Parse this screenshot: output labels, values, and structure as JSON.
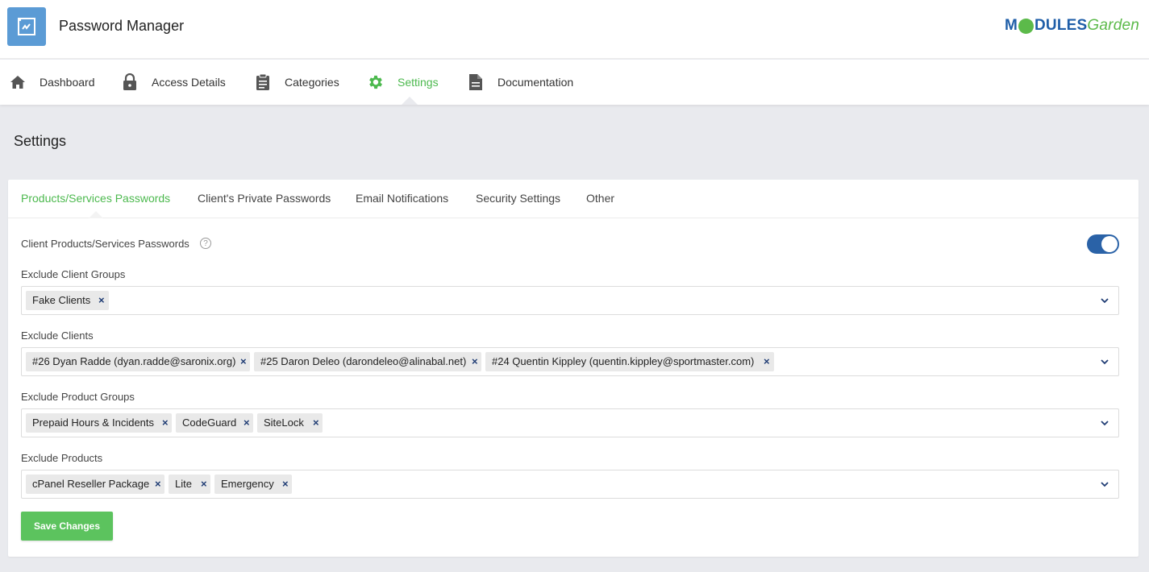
{
  "app": {
    "title": "Password Manager",
    "brand_left": "M",
    "brand_mid": "DULES",
    "brand_right": "Garden"
  },
  "nav": {
    "items": [
      {
        "label": "Dashboard",
        "icon": "home-icon"
      },
      {
        "label": "Access Details",
        "icon": "lock-icon"
      },
      {
        "label": "Categories",
        "icon": "clipboard-icon"
      },
      {
        "label": "Settings",
        "icon": "gear-icon",
        "active": true
      },
      {
        "label": "Documentation",
        "icon": "document-icon"
      }
    ]
  },
  "page": {
    "title": "Settings"
  },
  "tabs": [
    {
      "label": "Products/Services Passwords",
      "active": true
    },
    {
      "label": "Client's Private Passwords"
    },
    {
      "label": "Email Notifications"
    },
    {
      "label": "Security Settings"
    },
    {
      "label": "Other"
    }
  ],
  "form": {
    "toggle_label": "Client Products/Services Passwords",
    "toggle_on": true,
    "help_glyph": "?",
    "remove_glyph": "×",
    "client_groups": {
      "label": "Exclude Client Groups",
      "tags": [
        "Fake Clients"
      ]
    },
    "clients": {
      "label": "Exclude Clients",
      "tags": [
        "#26 Dyan Radde (dyan.radde@saronix.org)",
        "#25 Daron Deleo (darondeleo@alinabal.net)",
        "#24 Quentin Kippley (quentin.kippley@sportmaster.com)"
      ]
    },
    "product_groups": {
      "label": "Exclude Product Groups",
      "tags": [
        "Prepaid Hours & Incidents",
        "CodeGuard",
        "SiteLock"
      ]
    },
    "products": {
      "label": "Exclude Products",
      "tags": [
        "cPanel Reseller Package",
        "Lite",
        "Emergency"
      ]
    },
    "save_label": "Save Changes"
  },
  "colors": {
    "accent": "#4cb94e",
    "brand_blue": "#1f5ea8",
    "toggle": "#2a62a7",
    "button": "#5cc35e"
  }
}
